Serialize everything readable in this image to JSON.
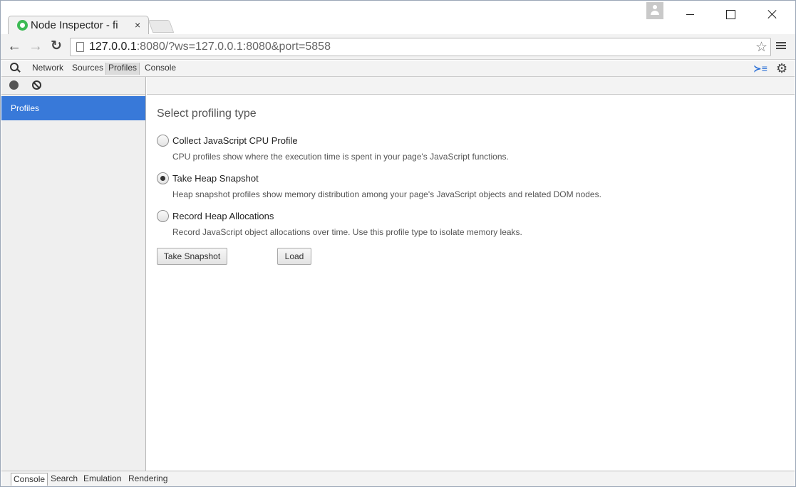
{
  "window": {
    "tab_title": "Node Inspector - fi",
    "tab_close": "×"
  },
  "toolbar": {
    "back": "←",
    "forward": "→",
    "reload": "↻",
    "url_host": "127.0.0.1",
    "url_rest": ":8080/?ws=127.0.0.1:8080&port=5858",
    "star": "☆"
  },
  "devtools": {
    "tabs": [
      "Network",
      "Sources",
      "Profiles",
      "Console"
    ],
    "active_tab": "Profiles",
    "drawer_toggle": "≻≡",
    "settings": "⚙"
  },
  "sidebar": {
    "items": [
      {
        "label": "Profiles"
      }
    ]
  },
  "main": {
    "heading": "Select profiling type",
    "options": [
      {
        "label": "Collect JavaScript CPU Profile",
        "description": "CPU profiles show where the execution time is spent in your page's JavaScript functions.",
        "checked": false
      },
      {
        "label": "Take Heap Snapshot",
        "description": "Heap snapshot profiles show memory distribution among your page's JavaScript objects and related DOM nodes.",
        "checked": true
      },
      {
        "label": "Record Heap Allocations",
        "description": "Record JavaScript object allocations over time. Use this profile type to isolate memory leaks.",
        "checked": false
      }
    ],
    "primary_button": "Take Snapshot",
    "load_button": "Load"
  },
  "drawer": {
    "tabs": [
      "Console",
      "Search",
      "Emulation",
      "Rendering"
    ],
    "active_tab": "Console"
  },
  "colors": {
    "selection": "#3879d9",
    "drawer_toggle": "#2a6fd6"
  }
}
